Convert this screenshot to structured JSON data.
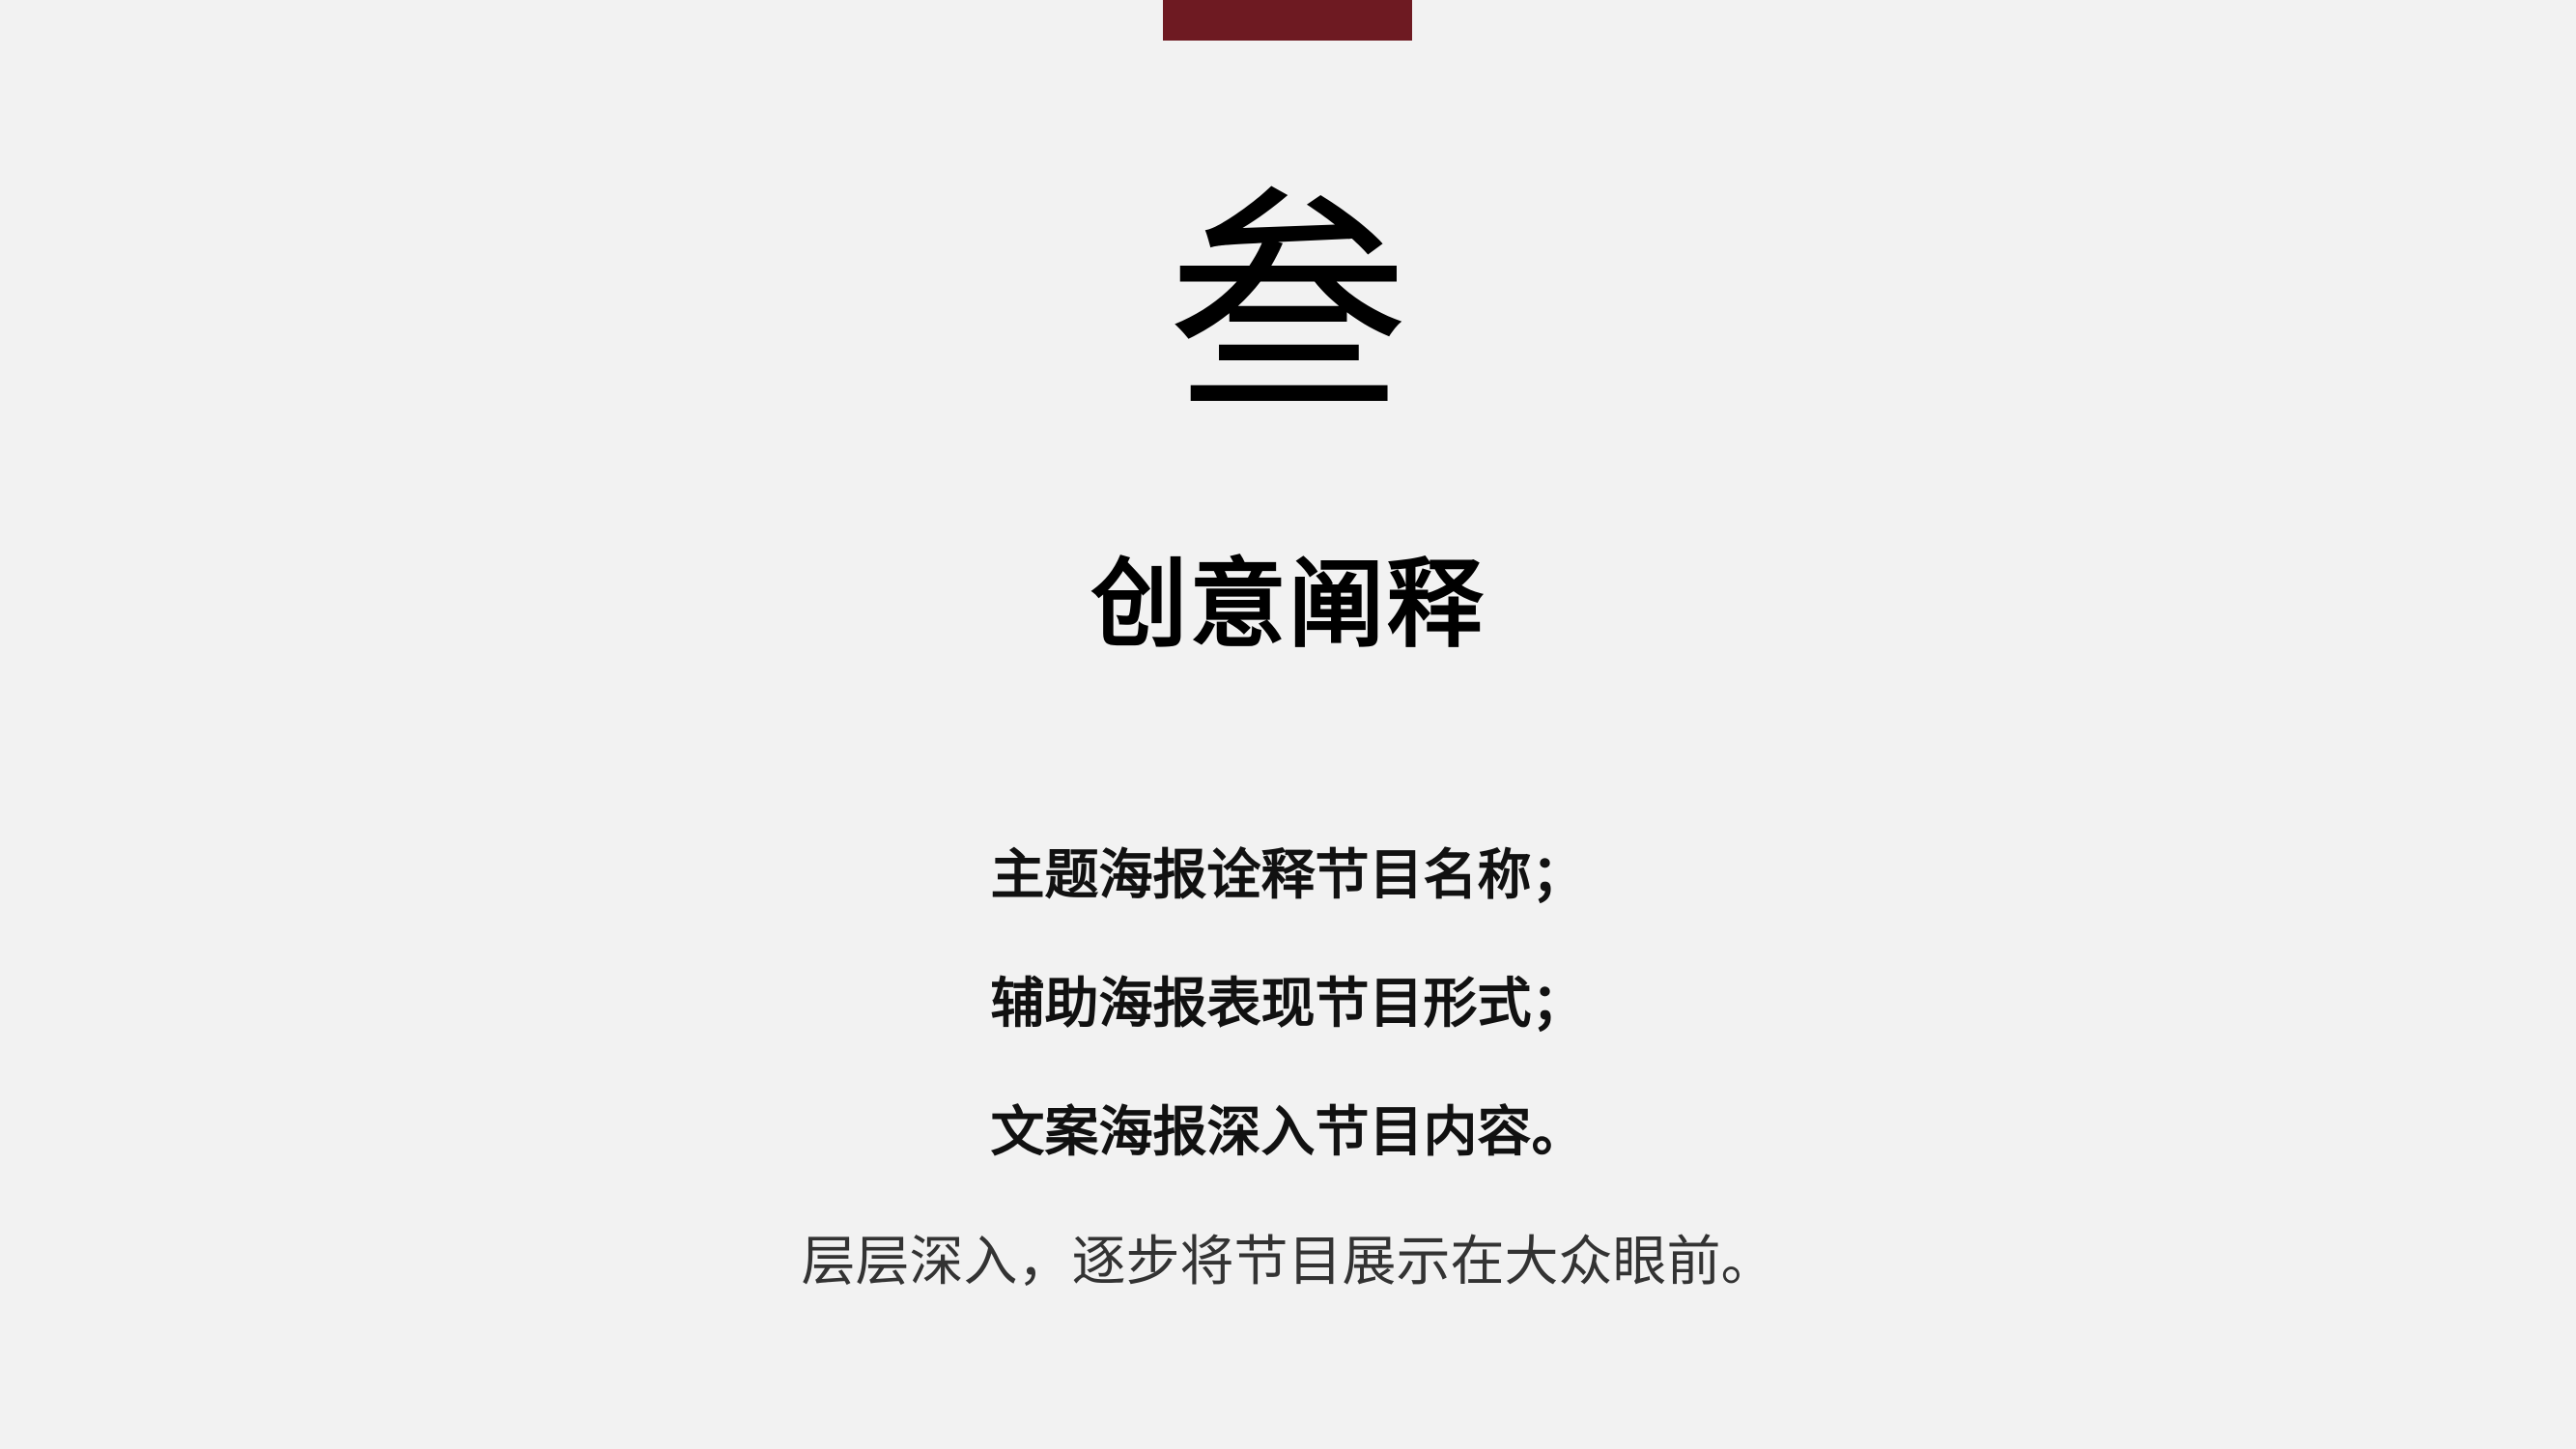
{
  "colors": {
    "background": "#f2f2f2",
    "accent": "#6e1a22",
    "text": "#000000"
  },
  "section_numeral": "叁",
  "section_title": "创意阐释",
  "body_lines": [
    "主题海报诠释节目名称；",
    "辅助海报表现节目形式；",
    "文案海报深入节目内容。"
  ],
  "closing_line": "层层深入，逐步将节目展示在大众眼前。"
}
